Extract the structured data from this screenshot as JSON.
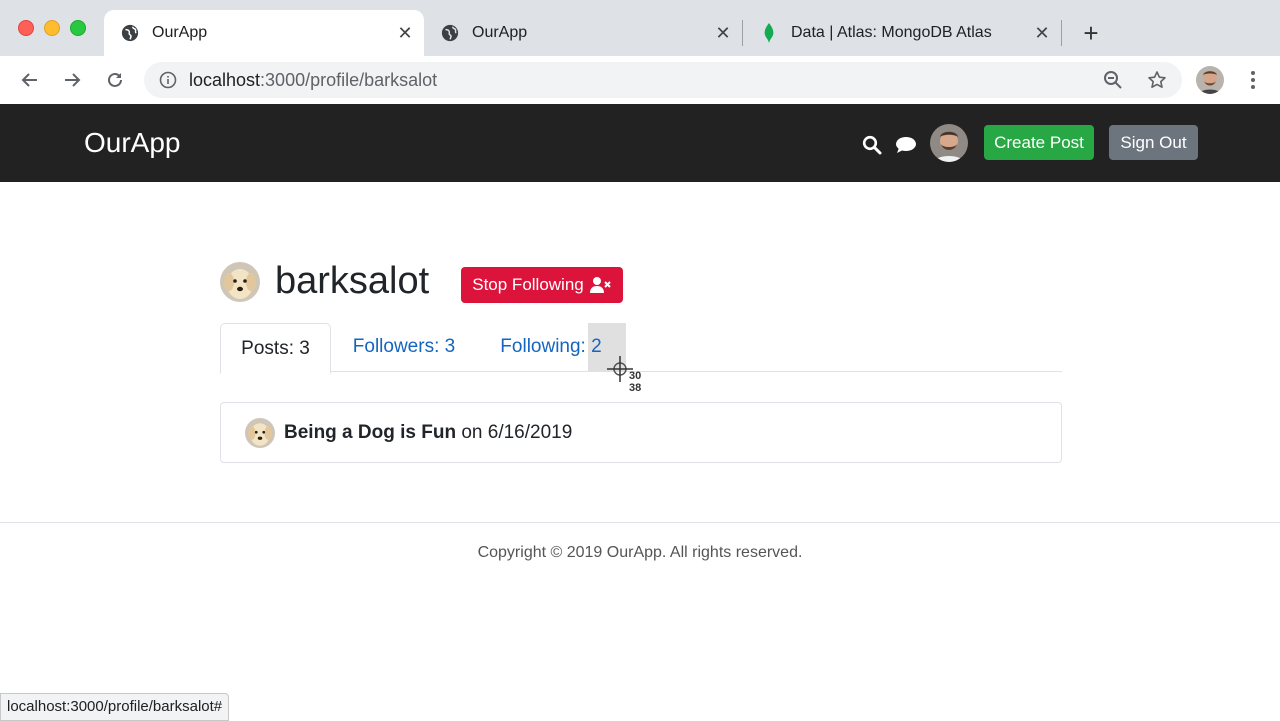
{
  "browser": {
    "tabs": [
      {
        "title": "OurApp",
        "icon": "globe-icon",
        "active": true
      },
      {
        "title": "OurApp",
        "icon": "globe-icon",
        "active": false
      },
      {
        "title": "Data | Atlas: MongoDB Atlas",
        "icon": "mongodb-leaf-icon",
        "active": false
      }
    ],
    "url_host": "localhost",
    "url_path": ":3000/profile/barksalot",
    "status_url": "localhost:3000/profile/barksalot#"
  },
  "header": {
    "brand": "OurApp",
    "create_post_label": "Create Post",
    "sign_out_label": "Sign Out"
  },
  "profile": {
    "username": "barksalot",
    "stop_following_label": "Stop Following",
    "tabs": [
      {
        "label": "Posts: 3",
        "active": true
      },
      {
        "label": "Followers: 3",
        "active": false
      },
      {
        "label": "Following: 2",
        "active": false
      }
    ],
    "posts": [
      {
        "title": "Being a Dog is Fun",
        "on": "on",
        "date": "6/16/2019"
      }
    ]
  },
  "cursor_readout": {
    "line1": "30",
    "line2": "38"
  },
  "footer": {
    "copyright": "Copyright © 2019 OurApp. All rights reserved."
  },
  "colors": {
    "create_button": "#28a745",
    "sign_out_button": "#6c757d",
    "stop_following_button": "#dc143c",
    "header_bg": "#222222",
    "link": "#1565c0"
  }
}
